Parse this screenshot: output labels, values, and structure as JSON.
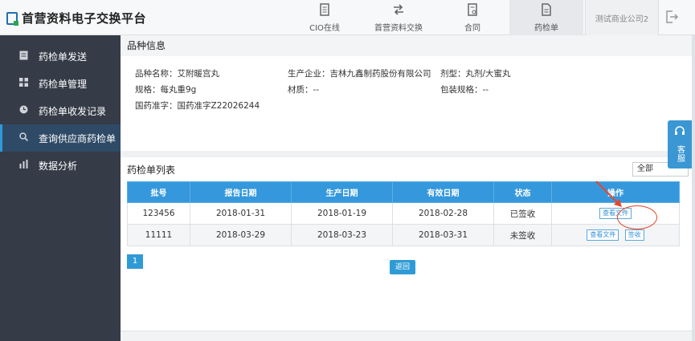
{
  "header": {
    "logo_text": "首营资料电子交换平台",
    "nav": [
      {
        "label": "CIO在线",
        "icon": "document-icon"
      },
      {
        "label": "首营资料交换",
        "icon": "exchange-icon"
      },
      {
        "label": "合同",
        "icon": "contract-icon"
      },
      {
        "label": "药检单",
        "icon": "report-icon"
      }
    ],
    "company": "测试商业公司2"
  },
  "sidebar": {
    "items": [
      {
        "label": "药检单发送",
        "icon": "send-icon"
      },
      {
        "label": "药检单管理",
        "icon": "grid-icon"
      },
      {
        "label": "药检单收发记录",
        "icon": "clock-icon"
      },
      {
        "label": "查询供应商药检单",
        "icon": "search-icon"
      },
      {
        "label": "数据分析",
        "icon": "bar-chart-icon"
      }
    ]
  },
  "product": {
    "section_title": "品种信息",
    "name": "品种名称：艾附暖宫丸",
    "manufacturer": "生产企业：吉林九鑫制药股份有限公司",
    "dosage_form": "剂型：丸剂/大蜜丸",
    "spec": "规格：每丸重9g",
    "material": "材质：--",
    "package_spec": "包装规格：--",
    "approval": "国药准字：国药准字Z22026244"
  },
  "list": {
    "title": "药检单列表",
    "filter_value": "全部",
    "columns": [
      "批号",
      "报告日期",
      "生产日期",
      "有效日期",
      "状态",
      "操作"
    ],
    "rows": [
      {
        "batch": "123456",
        "report_date": "2018-01-31",
        "prod_date": "2018-01-19",
        "exp_date": "2018-02-28",
        "status": "已签收"
      },
      {
        "batch": "11111",
        "report_date": "2018-03-29",
        "prod_date": "2018-03-23",
        "exp_date": "2018-03-31",
        "status": "未签收"
      }
    ],
    "view_file_label": "查看文件",
    "sign_label": "签收",
    "page": "1",
    "back_label": "返回"
  },
  "float": {
    "label": "客服"
  },
  "colors": {
    "accent": "#2f9bd6",
    "table_header": "#3598dc",
    "sidebar_bg": "#353c48",
    "annotation": "#e8462a"
  }
}
